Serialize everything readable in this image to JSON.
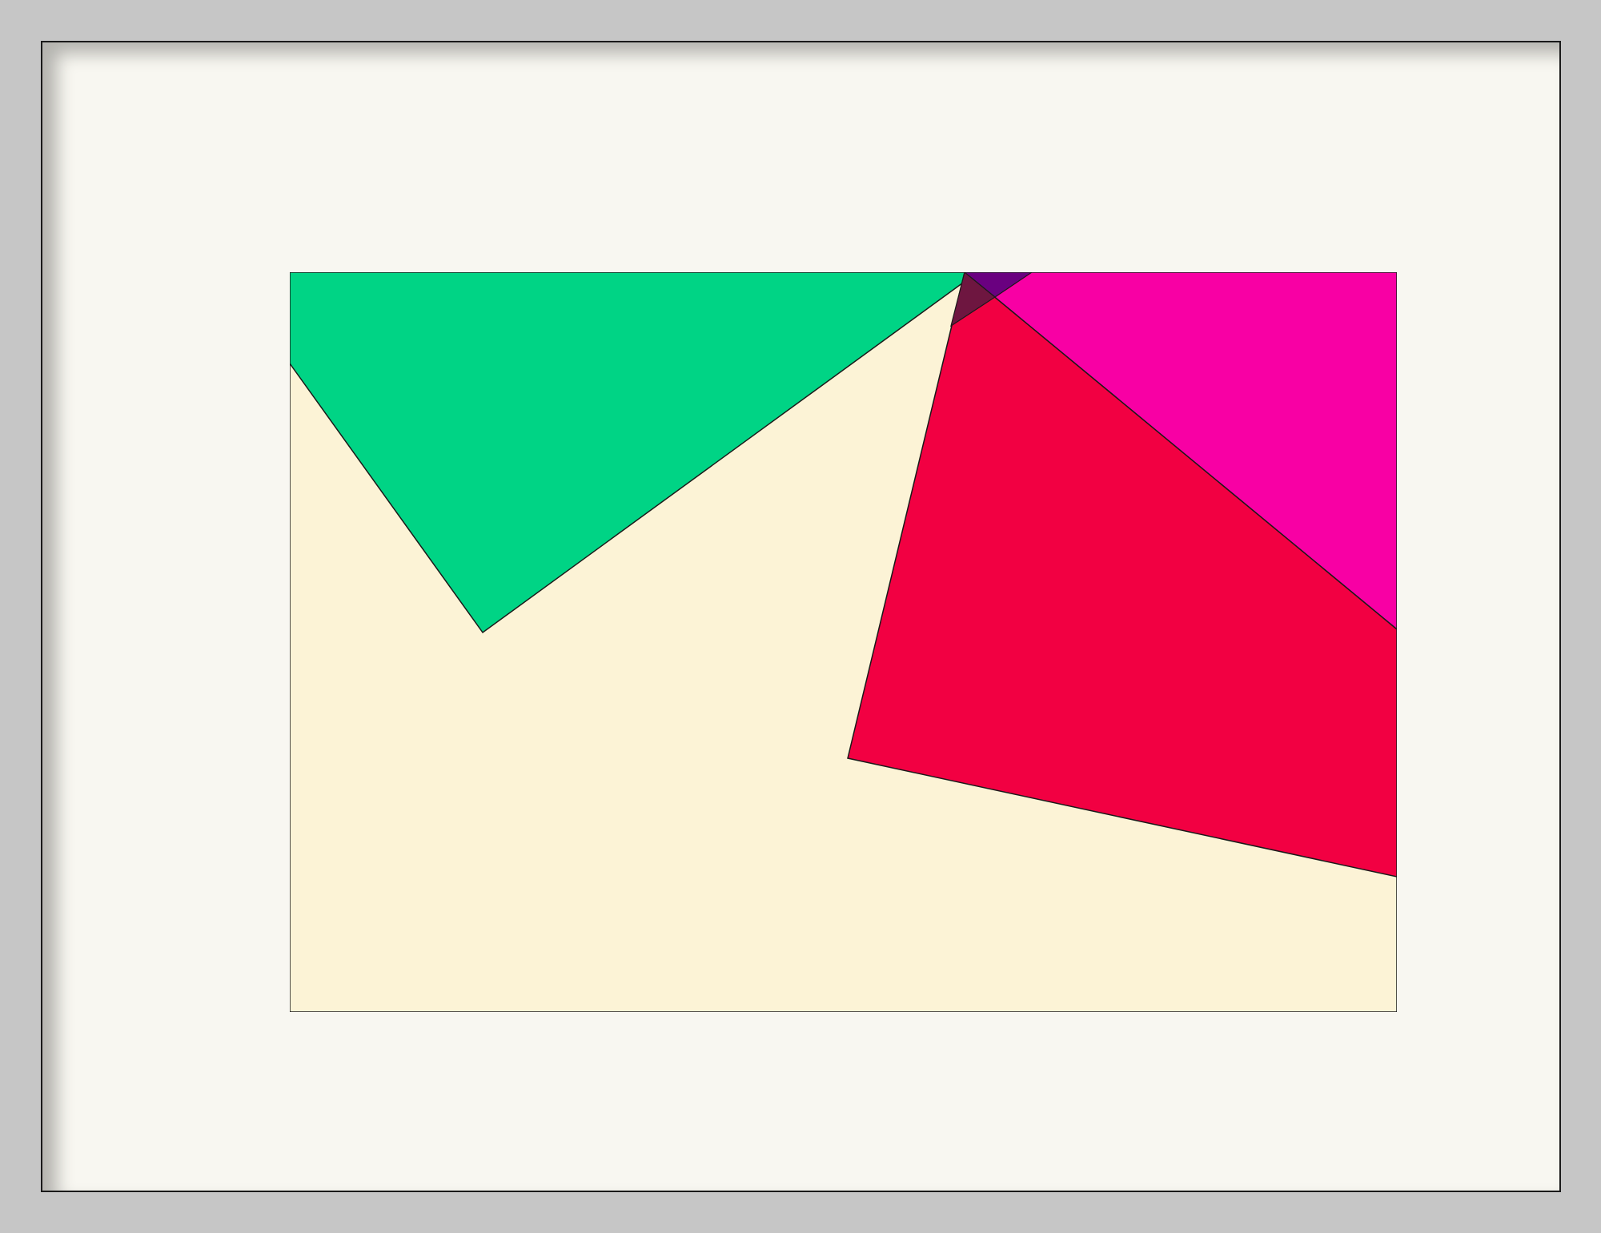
{
  "artwork": {
    "colors": {
      "frame": "#c6c6c6",
      "mat": "#f8f7f1",
      "background": "#fcf3d6",
      "green": "#00d485",
      "pink": "#f800a4",
      "red": "#f20042",
      "overlap_dark": "#6e1640",
      "overlap_purple": "#6a0080",
      "stroke": "#1a1a1a"
    }
  }
}
